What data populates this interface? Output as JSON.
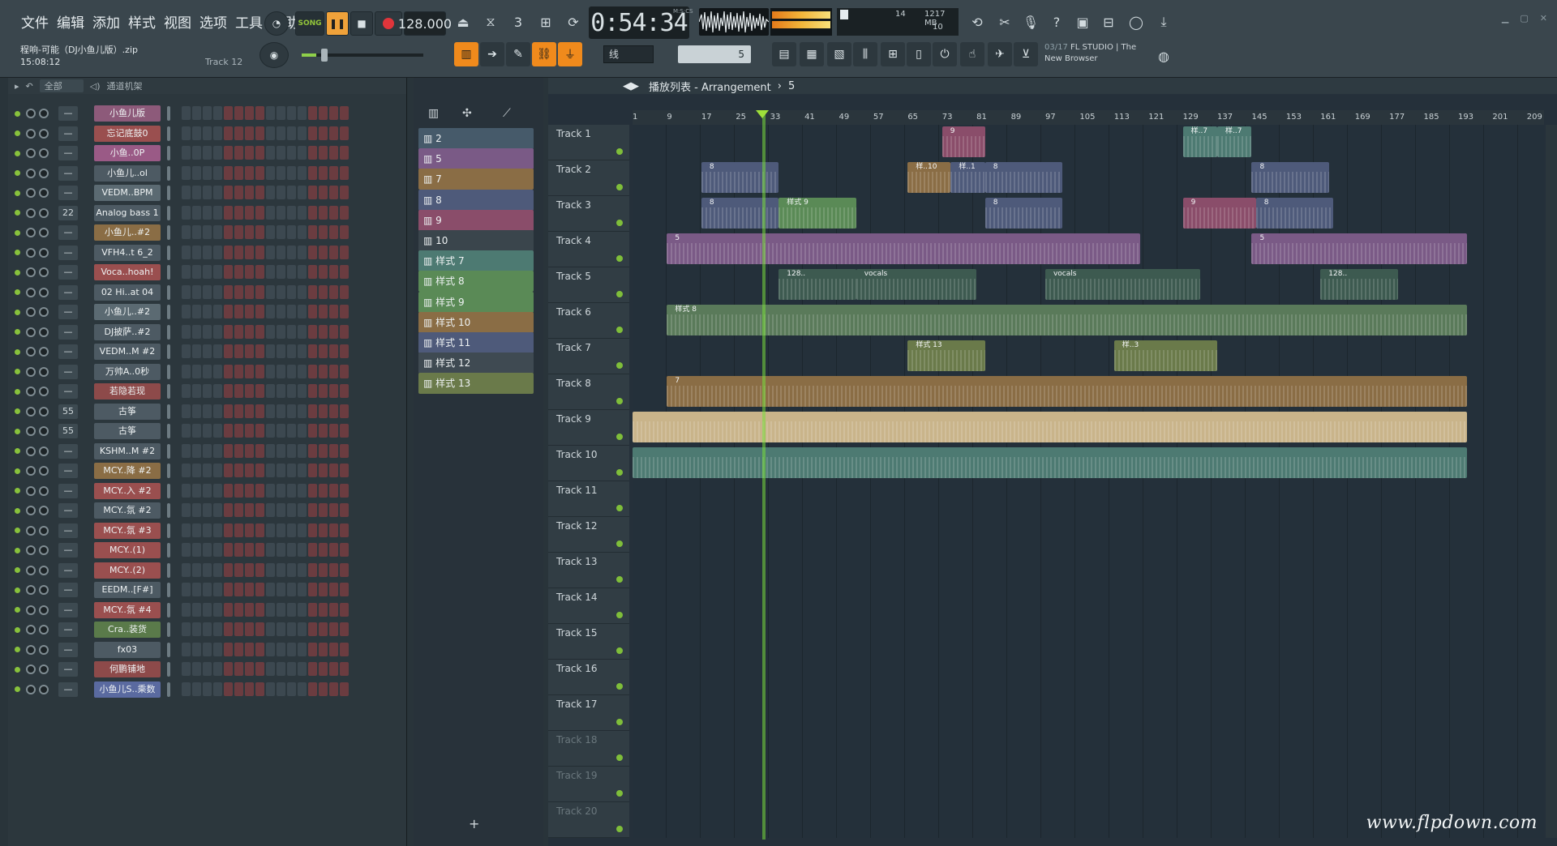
{
  "menu": [
    "文件",
    "编辑",
    "添加",
    "样式",
    "视图",
    "选项",
    "工具",
    "帮助"
  ],
  "song": {
    "title": "程响-可能（DJ小鱼儿版）.zip",
    "time": "15:08:12",
    "track_hint": "Track 12"
  },
  "transport": {
    "song_label": "SONG",
    "tempo": "128.000",
    "time": "0:54:34",
    "time_unit": "M:S:CS"
  },
  "cpu": {
    "value": "14",
    "memory": "1217 MB",
    "poly": "10"
  },
  "news": {
    "date": "03/17",
    "line1": "FL STUDIO | The",
    "line2": "New Browser"
  },
  "toolbar2": {
    "snap": "线",
    "pattern": "5"
  },
  "rack": {
    "filter": "全部",
    "title": "通道机架"
  },
  "channels": [
    {
      "num": "—",
      "name": "小鱼儿版",
      "color": "#8d5a7a"
    },
    {
      "num": "—",
      "name": "忘记底鼓0",
      "color": "#9a4f4f"
    },
    {
      "num": "—",
      "name": "小鱼..0P",
      "color": "#9a5a86"
    },
    {
      "num": "—",
      "name": "小鱼儿..ol",
      "color": "#4d5a63"
    },
    {
      "num": "—",
      "name": "VEDM..BPM",
      "color": "#5b6a72"
    },
    {
      "num": "22",
      "name": "Analog bass 1",
      "color": "#4d5a63"
    },
    {
      "num": "—",
      "name": "小鱼儿..#2",
      "color": "#8a6d45"
    },
    {
      "num": "—",
      "name": "VFH4..t 6_2",
      "color": "#4d5a63"
    },
    {
      "num": "—",
      "name": "Voca..hoah!",
      "color": "#9a4f4f"
    },
    {
      "num": "—",
      "name": "02 Hi..at 04",
      "color": "#4d5a63"
    },
    {
      "num": "—",
      "name": "小鱼儿..#2",
      "color": "#5b6a72"
    },
    {
      "num": "—",
      "name": "DJ披萨..#2",
      "color": "#4d5a63"
    },
    {
      "num": "—",
      "name": "VEDM..M #2",
      "color": "#4d5a63"
    },
    {
      "num": "—",
      "name": "万帅A..0秒",
      "color": "#4d5a63"
    },
    {
      "num": "—",
      "name": "若隐若现",
      "color": "#8d4a4a"
    },
    {
      "num": "55",
      "name": "古筝",
      "color": "#4d5a63"
    },
    {
      "num": "55",
      "name": "古筝",
      "color": "#4d5a63"
    },
    {
      "num": "—",
      "name": "KSHM..M #2",
      "color": "#4d5a63"
    },
    {
      "num": "—",
      "name": "MCY..降 #2",
      "color": "#8a6d45"
    },
    {
      "num": "—",
      "name": "MCY..入 #2",
      "color": "#9a4f4f"
    },
    {
      "num": "—",
      "name": "MCY..氛 #2",
      "color": "#4d5a63"
    },
    {
      "num": "—",
      "name": "MCY..氛 #3",
      "color": "#9a4f4f"
    },
    {
      "num": "—",
      "name": "MCY..(1)",
      "color": "#9a4f4f"
    },
    {
      "num": "—",
      "name": "MCY..(2)",
      "color": "#9a4f4f"
    },
    {
      "num": "—",
      "name": "EEDM..[F#]",
      "color": "#4d5a63"
    },
    {
      "num": "—",
      "name": "MCY..氛 #4",
      "color": "#9a4f4f"
    },
    {
      "num": "—",
      "name": "Cra..装货",
      "color": "#5a7a4a"
    },
    {
      "num": "—",
      "name": "fx03",
      "color": "#4d5a63"
    },
    {
      "num": "—",
      "name": "何鹏铺地",
      "color": "#8d4a4a"
    },
    {
      "num": "—",
      "name": "小鱼儿S..乘数",
      "color": "#5a6aa0"
    }
  ],
  "picker": [
    {
      "label": "2",
      "color": "#465a6a"
    },
    {
      "label": "5",
      "color": "#7a5a86"
    },
    {
      "label": "7",
      "color": "#8a6d45"
    },
    {
      "label": "8",
      "color": "#4e5a7a"
    },
    {
      "label": "9",
      "color": "#8a4d6a"
    },
    {
      "label": "10",
      "color": "#3a454c"
    },
    {
      "label": "样式 7",
      "color": "#4d7a72"
    },
    {
      "label": "样式 8",
      "color": "#5a8a56"
    },
    {
      "label": "样式 9",
      "color": "#5a8a56"
    },
    {
      "label": "样式 10",
      "color": "#8a6d45"
    },
    {
      "label": "样式 11",
      "color": "#4e5a7a"
    },
    {
      "label": "样式 12",
      "color": "#3f4a52"
    },
    {
      "label": "样式 13",
      "color": "#6a7a4a"
    }
  ],
  "playlist": {
    "title": "播放列表 - Arrangement",
    "pattern": "5"
  },
  "ruler": [
    "1",
    "9",
    "17",
    "25",
    "33",
    "41",
    "49",
    "57",
    "65",
    "73",
    "81",
    "89",
    "97",
    "105",
    "113",
    "121",
    "129",
    "137",
    "145",
    "153",
    "161",
    "169",
    "177",
    "185",
    "193",
    "201",
    "209"
  ],
  "tracks": [
    "Track 1",
    "Track 2",
    "Track 3",
    "Track 4",
    "Track 5",
    "Track 6",
    "Track 7",
    "Track 8",
    "Track 9",
    "Track 10",
    "Track 11",
    "Track 12",
    "Track 13",
    "Track 14",
    "Track 15",
    "Track 16",
    "Track 17",
    "Track 18",
    "Track 19",
    "Track 20"
  ],
  "clips": [
    {
      "track": 0,
      "start": 73,
      "len": 10,
      "label": "9",
      "color": "#8a4d6a"
    },
    {
      "track": 0,
      "start": 129,
      "len": 8,
      "label": "样..7",
      "color": "#4d7a72"
    },
    {
      "track": 0,
      "start": 137,
      "len": 8,
      "label": "样..7",
      "color": "#4d7a72"
    },
    {
      "track": 1,
      "start": 17,
      "len": 18,
      "label": "8",
      "color": "#4e5a7a"
    },
    {
      "track": 1,
      "start": 65,
      "len": 10,
      "label": "样..10",
      "color": "#8a6d45"
    },
    {
      "track": 1,
      "start": 75,
      "len": 8,
      "label": "样..1",
      "color": "#4e5a7a"
    },
    {
      "track": 1,
      "start": 83,
      "len": 18,
      "label": "8",
      "color": "#4e5a7a"
    },
    {
      "track": 1,
      "start": 145,
      "len": 18,
      "label": "8",
      "color": "#4e5a7a"
    },
    {
      "track": 2,
      "start": 17,
      "len": 18,
      "label": "8",
      "color": "#4e5a7a"
    },
    {
      "track": 2,
      "start": 35,
      "len": 18,
      "label": "样式 9",
      "color": "#5a8a56"
    },
    {
      "track": 2,
      "start": 83,
      "len": 18,
      "label": "8",
      "color": "#4e5a7a"
    },
    {
      "track": 2,
      "start": 129,
      "len": 17,
      "label": "9",
      "color": "#8a4d6a"
    },
    {
      "track": 2,
      "start": 146,
      "len": 18,
      "label": "8",
      "color": "#4e5a7a"
    },
    {
      "track": 3,
      "start": 9,
      "len": 110,
      "label": "5",
      "color": "#7a5a86"
    },
    {
      "track": 3,
      "start": 145,
      "len": 50,
      "label": "5",
      "color": "#7a5a86"
    },
    {
      "track": 4,
      "start": 35,
      "len": 18,
      "label": "128..",
      "color": "#3d5a50"
    },
    {
      "track": 4,
      "start": 53,
      "len": 28,
      "label": "vocals",
      "color": "#3d5a50"
    },
    {
      "track": 4,
      "start": 97,
      "len": 36,
      "label": "vocals",
      "color": "#3d5a50"
    },
    {
      "track": 4,
      "start": 161,
      "len": 18,
      "label": "128..",
      "color": "#3d5a50"
    },
    {
      "track": 5,
      "start": 9,
      "len": 186,
      "label": "样式 8",
      "color": "#5a7a5a"
    },
    {
      "track": 6,
      "start": 65,
      "len": 18,
      "label": "样式 13",
      "color": "#6a7a4a"
    },
    {
      "track": 6,
      "start": 113,
      "len": 24,
      "label": "样..3",
      "color": "#6a7a4a"
    },
    {
      "track": 7,
      "start": 9,
      "len": 186,
      "label": "7",
      "color": "#8a6d45"
    },
    {
      "track": 8,
      "start": 1,
      "len": 194,
      "label": "",
      "color": "#c9b48a"
    },
    {
      "track": 9,
      "start": 1,
      "len": 194,
      "label": "",
      "color": "#4d7a72"
    }
  ],
  "watermark": "www.flpdown.com"
}
